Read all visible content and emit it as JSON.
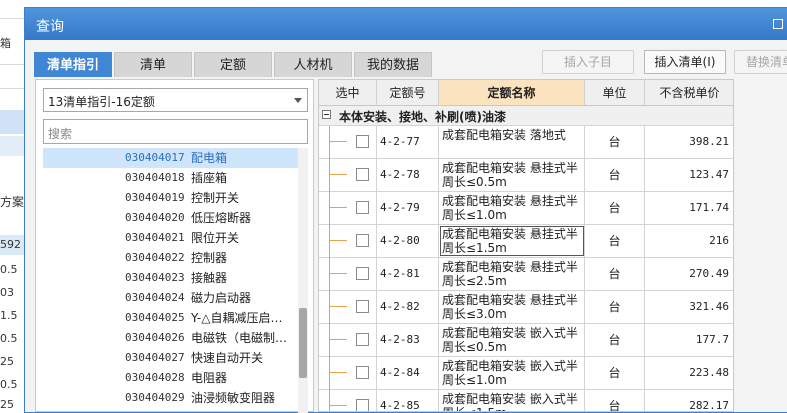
{
  "background": {
    "labels": [
      "箱",
      "方案",
      "592",
      "0.5",
      "03",
      "1.5",
      "0.5",
      "25",
      "0.5",
      "25"
    ]
  },
  "dialog": {
    "title": "查询"
  },
  "tabs": [
    {
      "label": "清单指引",
      "active": true
    },
    {
      "label": "清单",
      "active": false
    },
    {
      "label": "定额",
      "active": false
    },
    {
      "label": "人材机",
      "active": false
    },
    {
      "label": "我的数据",
      "active": false
    }
  ],
  "toolbar": {
    "insert_child": "插入子目",
    "insert_list": "插入清单(I)",
    "replace_list": "替换清单"
  },
  "left": {
    "select_value": "13清单指引-16定额",
    "search_placeholder": "搜索",
    "items": [
      {
        "code": "030404017",
        "name": "配电箱",
        "selected": true
      },
      {
        "code": "030404018",
        "name": "插座箱"
      },
      {
        "code": "030404019",
        "name": "控制开关"
      },
      {
        "code": "030404020",
        "name": "低压熔断器"
      },
      {
        "code": "030404021",
        "name": "限位开关"
      },
      {
        "code": "030404022",
        "name": "控制器"
      },
      {
        "code": "030404023",
        "name": "接触器"
      },
      {
        "code": "030404024",
        "name": "磁力启动器"
      },
      {
        "code": "030404025",
        "name": "Y-△自耦减压启…"
      },
      {
        "code": "030404026",
        "name": "电磁铁（电磁制…"
      },
      {
        "code": "030404027",
        "name": "快速自动开关"
      },
      {
        "code": "030404028",
        "name": "电阻器"
      },
      {
        "code": "030404029",
        "name": "油浸频敏变阻器"
      }
    ]
  },
  "table": {
    "headers": [
      "选中",
      "定额号",
      "定额名称",
      "单位",
      "不含税单价"
    ],
    "group": "本体安装、接地、补刷(喷)油漆",
    "rows": [
      {
        "code": "4-2-77",
        "name": "成套配电箱安装 落地式",
        "unit": "台",
        "price": "398.21"
      },
      {
        "code": "4-2-78",
        "name": "成套配电箱安装 悬挂式半周长≤0.5m",
        "unit": "台",
        "price": "123.47"
      },
      {
        "code": "4-2-79",
        "name": "成套配电箱安装 悬挂式半周长≤1.0m",
        "unit": "台",
        "price": "171.74"
      },
      {
        "code": "4-2-80",
        "name": "成套配电箱安装 悬挂式半周长≤1.5m",
        "unit": "台",
        "price": "216"
      },
      {
        "code": "4-2-81",
        "name": "成套配电箱安装 悬挂式半周长≤2.5m",
        "unit": "台",
        "price": "270.49"
      },
      {
        "code": "4-2-82",
        "name": "成套配电箱安装 悬挂式半周长≤3.0m",
        "unit": "台",
        "price": "321.46"
      },
      {
        "code": "4-2-83",
        "name": "成套配电箱安装 嵌入式半周长≤0.5m",
        "unit": "台",
        "price": "177.7"
      },
      {
        "code": "4-2-84",
        "name": "成套配电箱安装 嵌入式半周长≤1.0m",
        "unit": "台",
        "price": "223.48"
      },
      {
        "code": "4-2-85",
        "name": "成套配电箱安装 嵌入式半周长≤1.5m",
        "unit": "台",
        "price": "282.17"
      }
    ]
  }
}
